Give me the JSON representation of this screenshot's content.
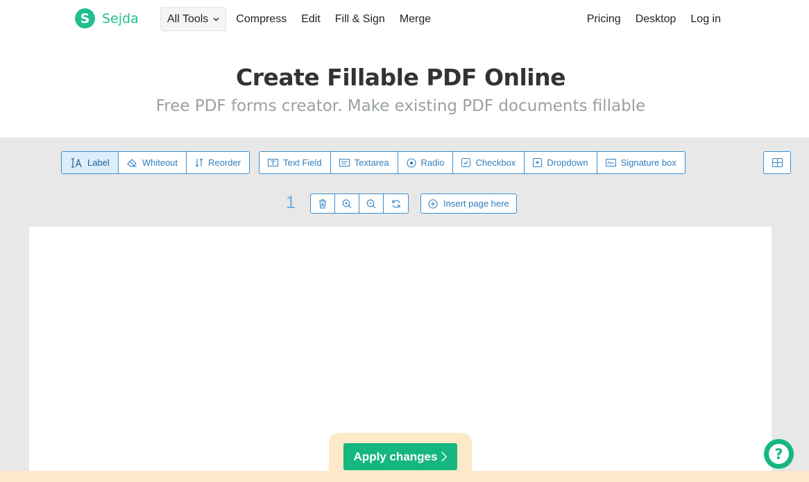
{
  "brand": {
    "logo_letter": "S",
    "name": "Sejda",
    "color": "#1fbf8f"
  },
  "nav": {
    "all_tools": "All Tools",
    "left_links": [
      "Compress",
      "Edit",
      "Fill & Sign",
      "Merge"
    ],
    "right_links": [
      "Pricing",
      "Desktop",
      "Log in"
    ]
  },
  "hero": {
    "title": "Create Fillable PDF Online",
    "subtitle": "Free PDF forms creator. Make existing PDF documents fillable"
  },
  "toolbar": {
    "group1": [
      {
        "label": "Label",
        "icon": "text-cursor-icon",
        "active": true
      },
      {
        "label": "Whiteout",
        "icon": "eraser-icon"
      },
      {
        "label": "Reorder",
        "icon": "reorder-arrows-icon"
      }
    ],
    "group2": [
      {
        "label": "Text Field",
        "icon": "text-field-icon"
      },
      {
        "label": "Textarea",
        "icon": "textarea-icon"
      },
      {
        "label": "Radio",
        "icon": "radio-icon"
      },
      {
        "label": "Checkbox",
        "icon": "checkbox-icon"
      },
      {
        "label": "Dropdown",
        "icon": "dropdown-icon"
      },
      {
        "label": "Signature box",
        "icon": "signature-icon"
      }
    ],
    "view_toggle_icon": "grid-view-icon"
  },
  "page": {
    "number": "1",
    "tools": [
      "trash-icon",
      "zoom-in-icon",
      "zoom-out-icon",
      "rotate-icon"
    ],
    "insert_label": "Insert page here"
  },
  "footer": {
    "apply_label": "Apply changes",
    "help_icon": "help-icon"
  },
  "colors": {
    "accent_blue": "#3b8fd1",
    "apply_green": "#16b77e",
    "workspace_bg": "#e8e8e8",
    "apply_bg": "#fde9c9"
  }
}
